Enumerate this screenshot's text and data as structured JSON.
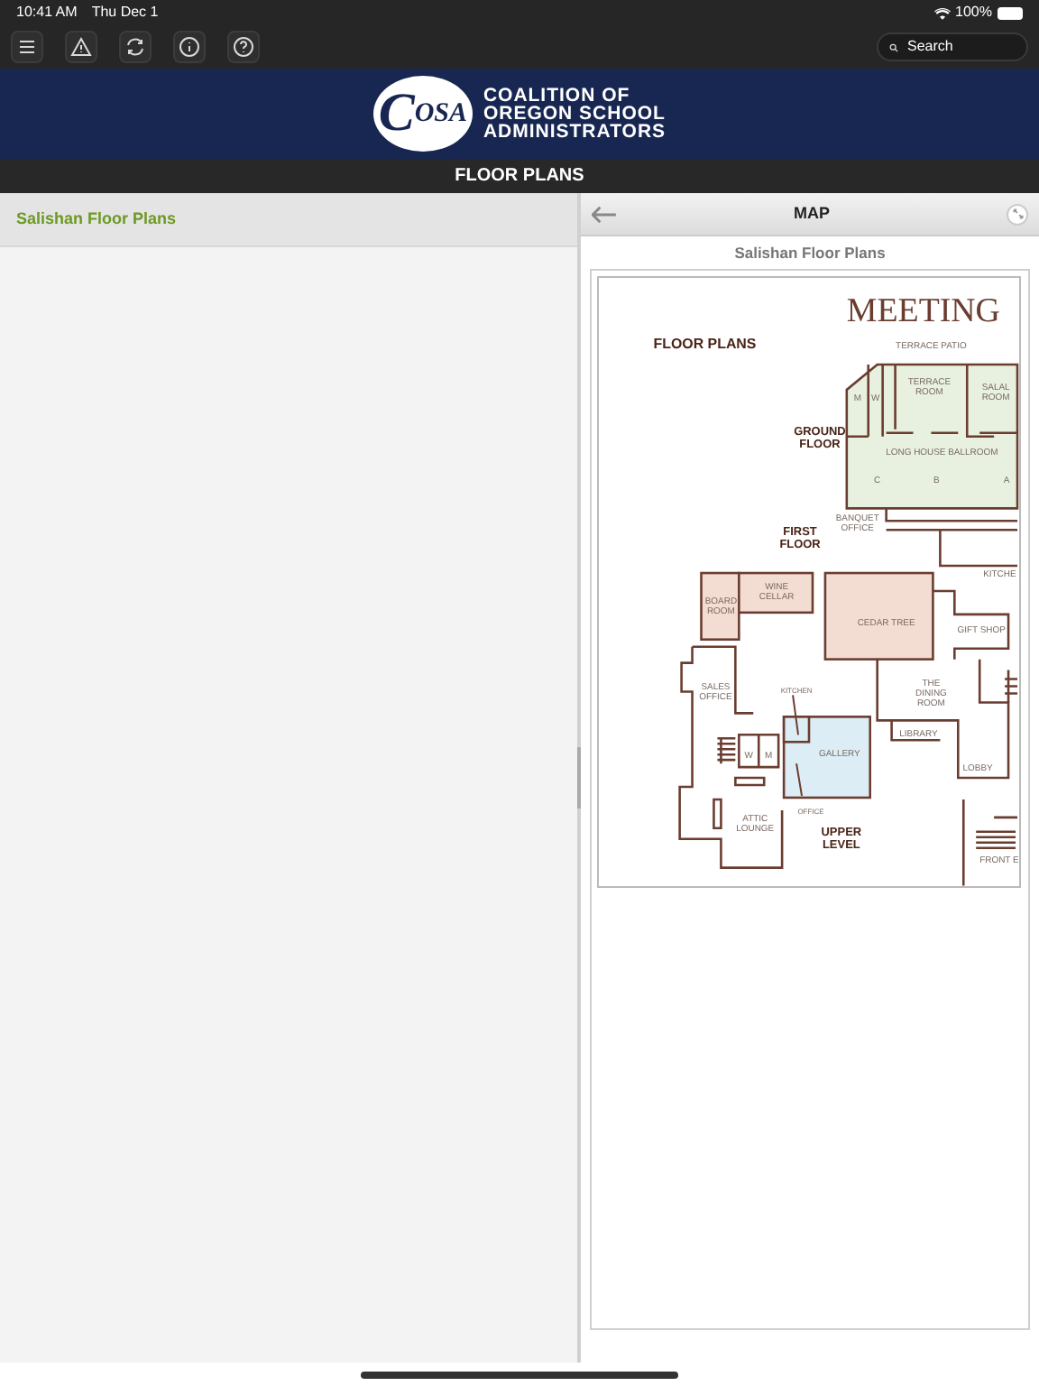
{
  "status_bar": {
    "time": "10:41 AM",
    "date": "Thu Dec 1",
    "battery": "100%"
  },
  "toolbar": {
    "search": {
      "placeholder": "Search"
    }
  },
  "banner": {
    "logo": {
      "initial": "C",
      "letters": "OSA"
    },
    "org_lines": [
      "COALITION OF",
      "OREGON SCHOOL",
      "ADMINISTRATORS"
    ]
  },
  "title": "FLOOR PLANS",
  "sidebar": {
    "items": [
      {
        "label": "Salishan Floor Plans",
        "selected": true
      }
    ]
  },
  "detail": {
    "title": "MAP",
    "subtitle": "Salishan Floor Plans",
    "map": {
      "heading": "MEETING",
      "labels": [
        {
          "kind": "title",
          "lines": [
            "FLOOR PLANS"
          ]
        },
        {
          "kind": "room",
          "lines": [
            "TERRACE PATIO"
          ]
        },
        {
          "kind": "room",
          "lines": [
            "M"
          ]
        },
        {
          "kind": "room",
          "lines": [
            "W"
          ]
        },
        {
          "kind": "room",
          "lines": [
            "TERRACE",
            "ROOM"
          ]
        },
        {
          "kind": "room",
          "lines": [
            "SALAL",
            "ROOM"
          ]
        },
        {
          "kind": "floor",
          "lines": [
            "GROUND",
            "FLOOR"
          ]
        },
        {
          "kind": "room",
          "lines": [
            "LONG HOUSE BALLROOM"
          ]
        },
        {
          "kind": "room",
          "lines": [
            "C"
          ]
        },
        {
          "kind": "room",
          "lines": [
            "B"
          ]
        },
        {
          "kind": "room",
          "lines": [
            "A"
          ]
        },
        {
          "kind": "room",
          "lines": [
            "BANQUET",
            "OFFICE"
          ]
        },
        {
          "kind": "floor",
          "lines": [
            "FIRST",
            "FLOOR"
          ]
        },
        {
          "kind": "room",
          "lines": [
            "KITCHE"
          ]
        },
        {
          "kind": "room",
          "lines": [
            "BOARD",
            "ROOM"
          ]
        },
        {
          "kind": "room",
          "lines": [
            "WINE",
            "CELLAR"
          ]
        },
        {
          "kind": "room",
          "lines": [
            "CEDAR TREE"
          ]
        },
        {
          "kind": "room",
          "lines": [
            "GIFT SHOP"
          ]
        },
        {
          "kind": "room",
          "lines": [
            "SALES",
            "OFFICE"
          ]
        },
        {
          "kind": "small",
          "lines": [
            "KITCHEN"
          ]
        },
        {
          "kind": "room",
          "lines": [
            "THE",
            "DINING",
            "ROOM"
          ]
        },
        {
          "kind": "room",
          "lines": [
            "LIBRARY"
          ]
        },
        {
          "kind": "room",
          "lines": [
            "W"
          ]
        },
        {
          "kind": "room",
          "lines": [
            "M"
          ]
        },
        {
          "kind": "room",
          "lines": [
            "GALLERY"
          ]
        },
        {
          "kind": "room",
          "lines": [
            "LOBBY"
          ]
        },
        {
          "kind": "small",
          "lines": [
            "OFFICE"
          ]
        },
        {
          "kind": "room",
          "lines": [
            "ATTIC",
            "LOUNGE"
          ]
        },
        {
          "kind": "floor",
          "lines": [
            "UPPER",
            "LEVEL"
          ]
        },
        {
          "kind": "room",
          "lines": [
            "FRONT E"
          ]
        }
      ]
    }
  }
}
